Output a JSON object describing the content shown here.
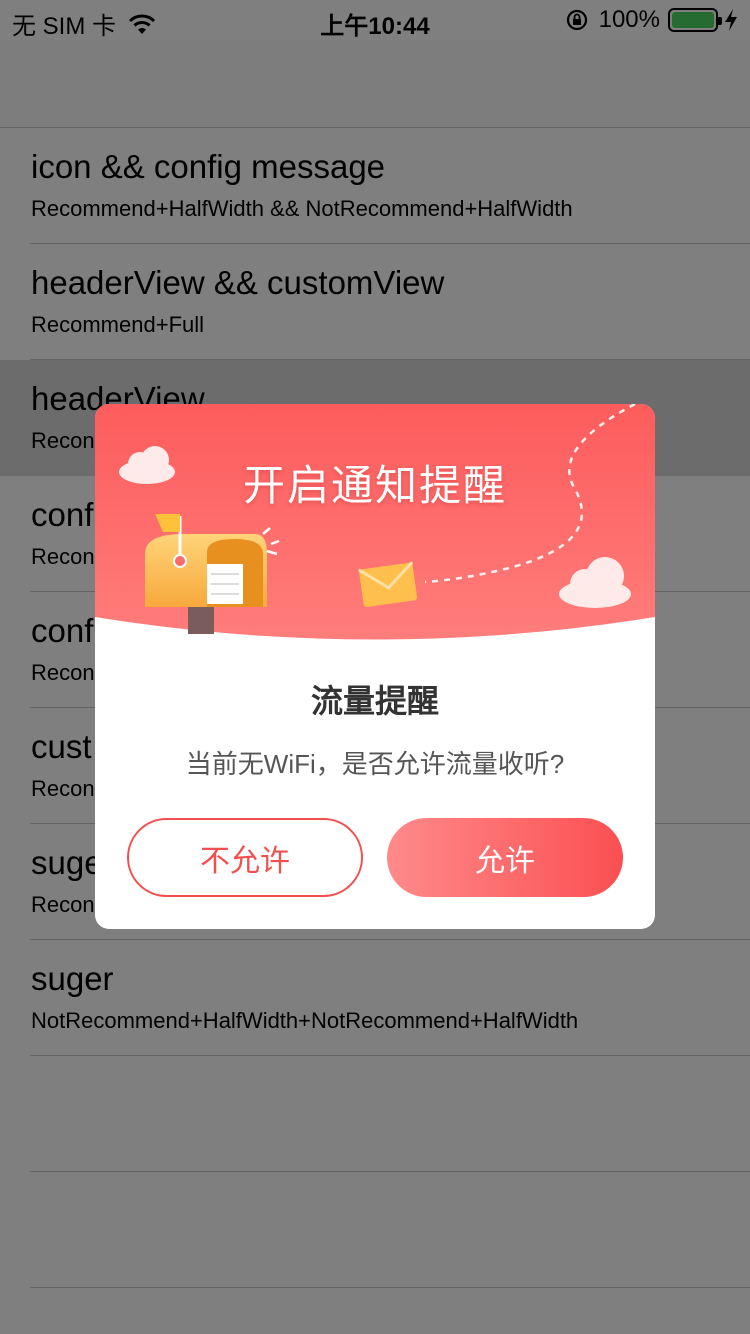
{
  "status_bar": {
    "carrier": "无 SIM 卡",
    "time": "上午10:44",
    "battery": "100%",
    "battery_color": "#4cd964"
  },
  "list": {
    "rows": [
      {
        "title": "icon && config message",
        "subtitle": "Recommend+HalfWidth && NotRecommend+HalfWidth"
      },
      {
        "title": "headerView && customView",
        "subtitle": "Recommend+Full"
      },
      {
        "title": "headerView",
        "subtitle": "Recon"
      },
      {
        "title": "conf",
        "subtitle": "Recon"
      },
      {
        "title": "conf",
        "subtitle": "Recon"
      },
      {
        "title": "cust",
        "subtitle": "Recon"
      },
      {
        "title": "suge",
        "subtitle": "Recon"
      },
      {
        "title": "suger",
        "subtitle": "NotRecommend+HalfWidth+NotRecommend+HalfWidth"
      },
      {
        "title": "",
        "subtitle": ""
      },
      {
        "title": "",
        "subtitle": ""
      }
    ]
  },
  "dialog": {
    "banner_title": "开启通知提醒",
    "title": "流量提醒",
    "message": "当前无WiFi，是否允许流量收听?",
    "deny_label": "不允许",
    "allow_label": "允许",
    "accent_color": "#f2504f",
    "banner_icons": [
      "mailbox-icon",
      "envelope-icon",
      "cloud-icon"
    ]
  }
}
